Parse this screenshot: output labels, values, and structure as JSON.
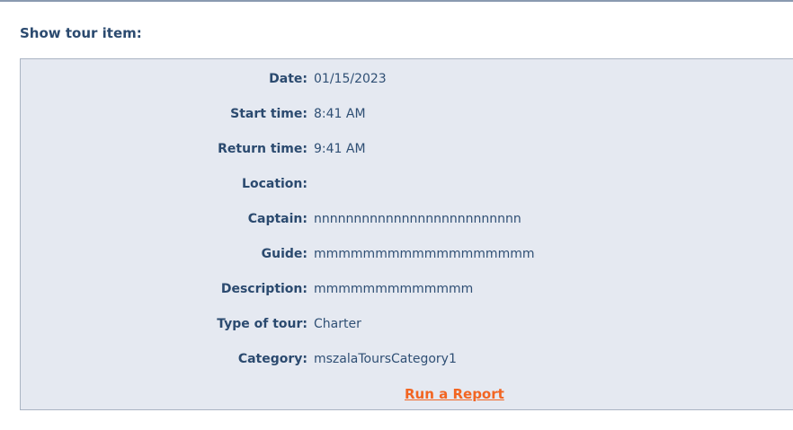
{
  "page": {
    "title": "Show tour item:"
  },
  "details": [
    {
      "label": "Date:",
      "value": "01/15/2023"
    },
    {
      "label": "Start time:",
      "value": "8:41 AM"
    },
    {
      "label": "Return time:",
      "value": "9:41 AM"
    },
    {
      "label": "Location:",
      "value": ""
    },
    {
      "label": "Captain:",
      "value": "nnnnnnnnnnnnnnnnnnnnnnnnnn"
    },
    {
      "label": "Guide:",
      "value": "mmmmmmmmmmmmmmmmmm"
    },
    {
      "label": "Description:",
      "value": "mmmmmmmmmmmmm"
    },
    {
      "label": "Type of tour:",
      "value": "Charter"
    },
    {
      "label": "Category:",
      "value": "mszalaToursCategory1"
    }
  ],
  "actions": {
    "run_report_label": "Run a Report"
  },
  "colors": {
    "label_text": "#2b4a6f",
    "panel_background": "#e5e9f1",
    "link": "#f26522"
  }
}
